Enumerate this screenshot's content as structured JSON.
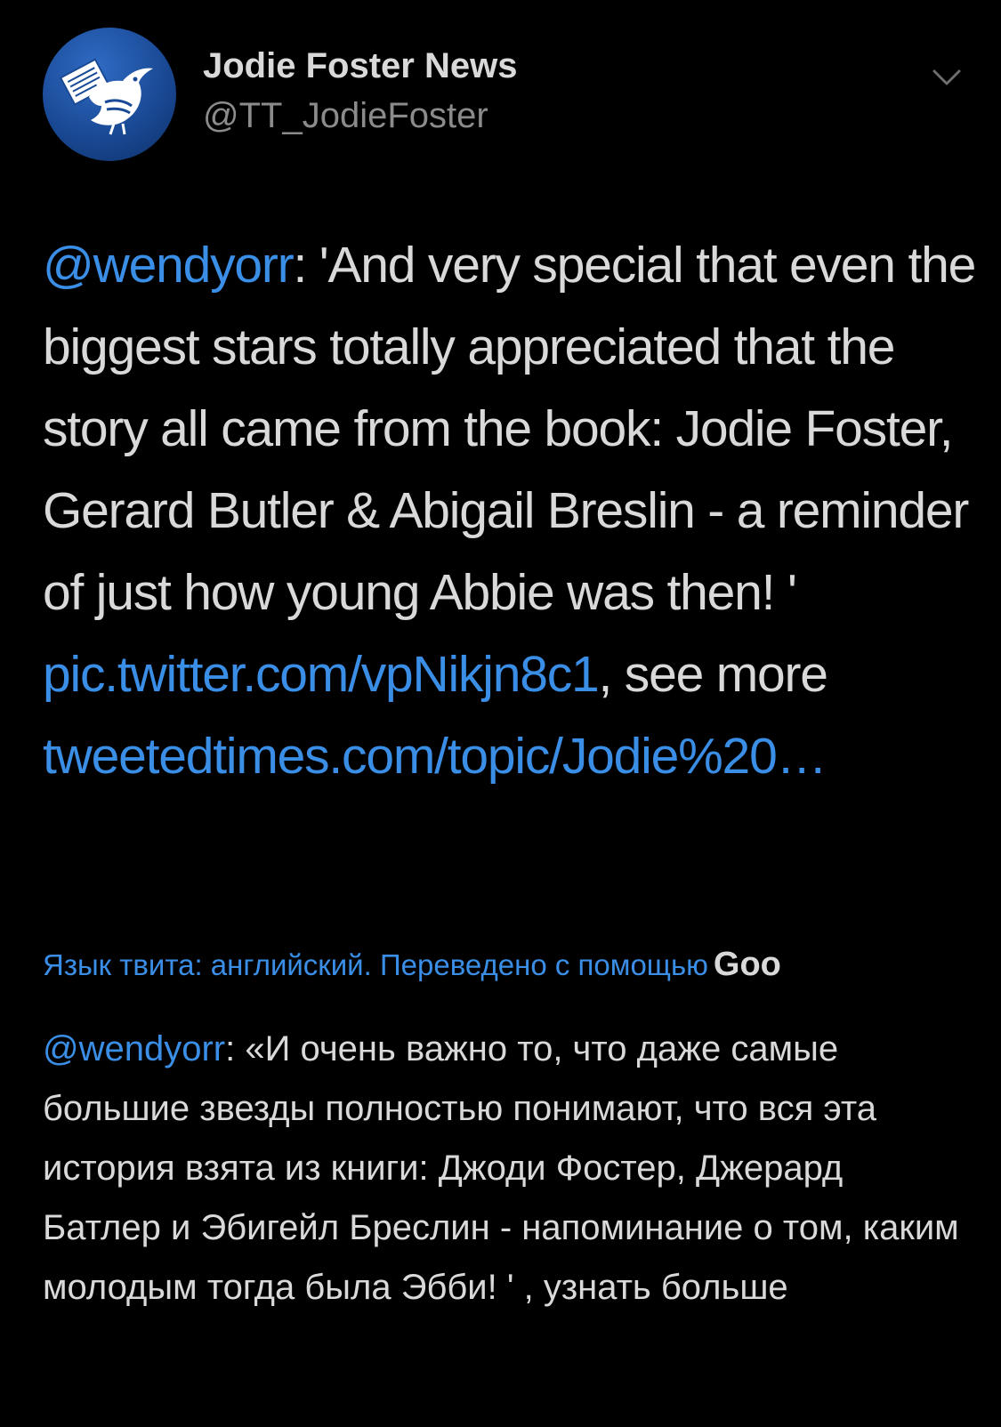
{
  "account": {
    "display_name": "Jodie Foster News",
    "handle": "@TT_JodieFoster"
  },
  "tweet": {
    "mention": "@wendyorr",
    "text_part1": ": 'And very special that even the biggest stars totally appreciated that the story all came from the book: Jodie Foster, Gerard Butler & Abigail Breslin - a reminder of just how young Abbie was then! ' ",
    "pic_link": "pic.twitter.com/vpNikjn8c1",
    "text_part2": ", see more ",
    "more_link": "tweetedtimes.com/topic/Jodie%20…"
  },
  "translation": {
    "note": "Язык твита: английский. Переведено с помощью",
    "provider": "Goo",
    "mention": "@wendyorr",
    "text": ": «И очень важно то, что даже самые большие звезды полностью понимают, что вся эта история взята из книги: Джоди Фостер, Джерард Батлер и Эбигейл Бреслин - напоминание о том, каким молодым тогда была Эбби! '  , узнать больше"
  },
  "icons": {
    "avatar": "bird-newspaper-logo-icon",
    "menu": "chevron-down-icon"
  },
  "colors": {
    "background": "#000000",
    "text": "#d9d9d9",
    "secondary": "#8b8b8b",
    "link": "#3a8ee6",
    "avatar_blue": "#1a4a96"
  }
}
